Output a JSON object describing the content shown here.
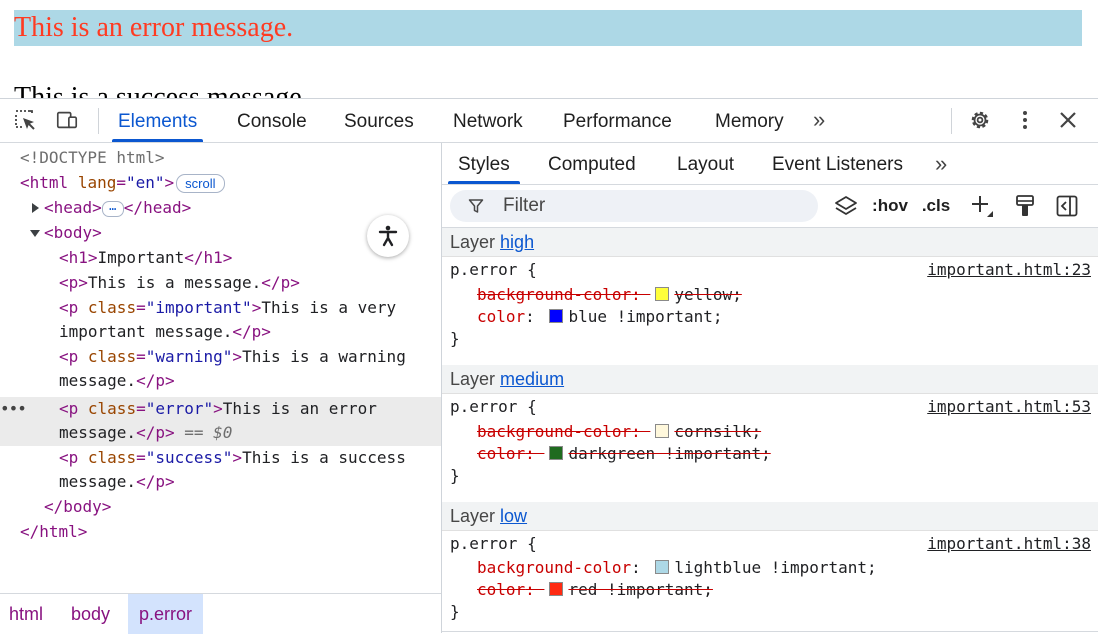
{
  "page": {
    "error_message": "This is an error message.",
    "success_message": "This is a success message."
  },
  "toolbar": {
    "tabs": [
      "Elements",
      "Console",
      "Sources",
      "Network",
      "Performance",
      "Memory"
    ],
    "more": "»",
    "icons": [
      "inspect-element-icon",
      "device-toggle-icon",
      "settings-icon",
      "more-vertical-icon",
      "close-icon"
    ]
  },
  "dom": {
    "lines": [
      "<!DOCTYPE html>",
      "<html",
      "lang",
      "\"en\"",
      ">",
      "scroll",
      "<head>",
      "</head>",
      "<body>",
      "<h1>",
      "Important",
      "</h1>",
      "<p>",
      "This is a message.",
      "</p>",
      "<p",
      "class",
      "\"important\"",
      "This is a very",
      "important message.",
      "\"warning\"",
      "This is a warning",
      "message.",
      "\"error\"",
      "This is an error",
      "== $0",
      "\"success\"",
      "This is a success",
      "</body>",
      "</html>"
    ]
  },
  "breadcrumb": [
    "html",
    "body",
    "p.error"
  ],
  "styles": {
    "subtabs": [
      "Styles",
      "Computed",
      "Layout",
      "Event Listeners"
    ],
    "filter_placeholder": "Filter",
    "hov": ":hov",
    "cls": ".cls",
    "layer_label": "Layer",
    "layers": [
      {
        "name": "high",
        "selector": "p.error {",
        "source": "important.html:23",
        "decls": [
          {
            "prop": "background-color",
            "value": "yellow;",
            "swatch": "#ffff3a",
            "struck": true
          },
          {
            "prop": "color",
            "value": "blue !important;",
            "swatch": "#0000ff",
            "struck": false
          }
        ]
      },
      {
        "name": "medium",
        "selector": "p.error {",
        "source": "important.html:53",
        "decls": [
          {
            "prop": "background-color",
            "value": "cornsilk;",
            "swatch": "#fff8dc",
            "struck": true
          },
          {
            "prop": "color",
            "value": "darkgreen !important;",
            "swatch": "#1f6b1f",
            "struck": true
          }
        ]
      },
      {
        "name": "low",
        "selector": "p.error {",
        "source": "important.html:38",
        "decls": [
          {
            "prop": "background-color",
            "value": "lightblue !important;",
            "swatch": "#add8e6",
            "struck": false
          },
          {
            "prop": "color",
            "value": "red !important;",
            "swatch": "#ff2a12",
            "struck": true
          }
        ]
      }
    ],
    "close_brace": "}"
  }
}
